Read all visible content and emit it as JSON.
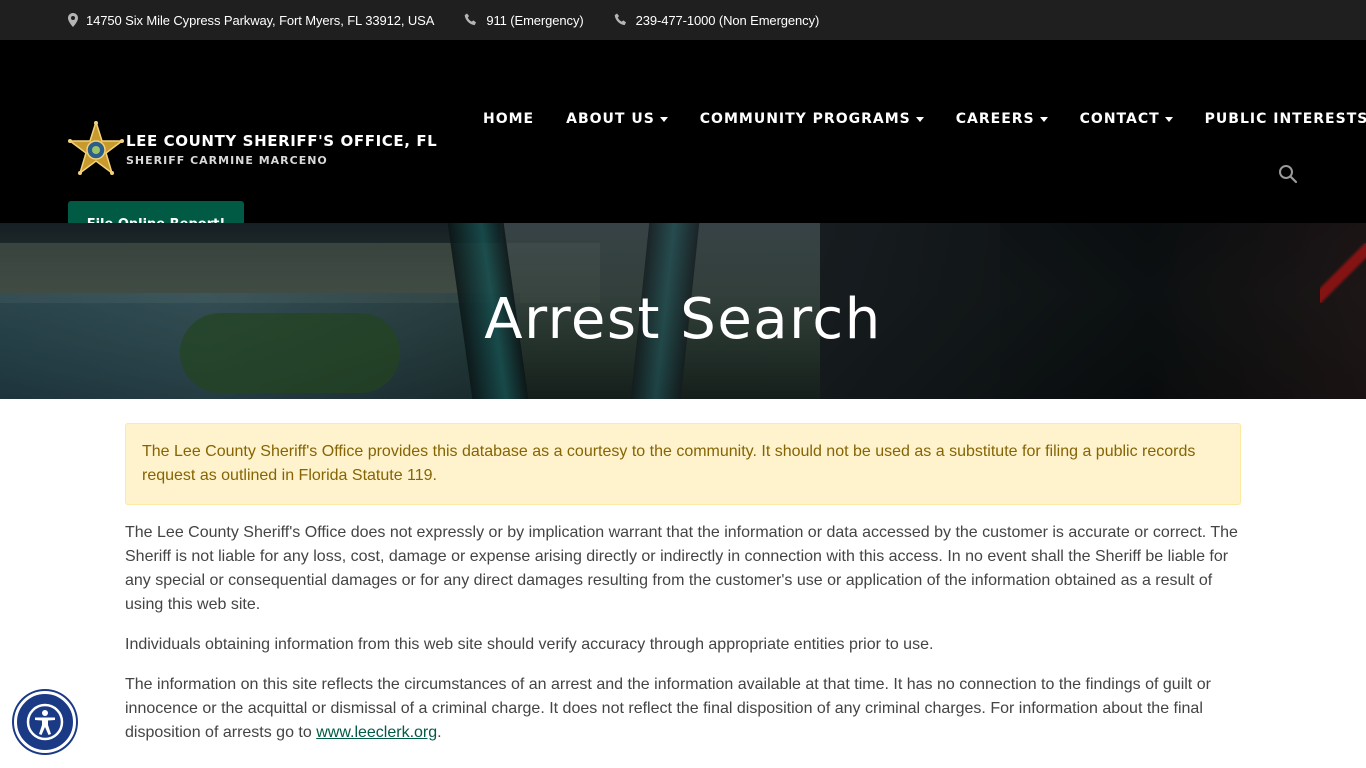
{
  "topbar": {
    "address": "14750 Six Mile Cypress Parkway, Fort Myers, FL 33912, USA",
    "emergency": "911 (Emergency)",
    "non_emergency": "239-477-1000 (Non Emergency)"
  },
  "brand": {
    "title": "LEE COUNTY SHERIFF'S OFFICE, FL",
    "subtitle": "SHERIFF CARMINE MARCENO"
  },
  "nav": [
    {
      "label": "HOME",
      "dropdown": false
    },
    {
      "label": "ABOUT US",
      "dropdown": true
    },
    {
      "label": "COMMUNITY PROGRAMS",
      "dropdown": true
    },
    {
      "label": "CAREERS",
      "dropdown": true
    },
    {
      "label": "CONTACT",
      "dropdown": true
    },
    {
      "label": "PUBLIC INTERESTS",
      "dropdown": true
    }
  ],
  "report_button": "File Online Report!",
  "hero_title": "Arrest Search",
  "alert_text": "The Lee County Sheriff's Office provides this database as a courtesy to the community. It should not be used as a substitute for filing a public records request as outlined in Florida Statute 119.",
  "paragraphs": {
    "disclaimer": "The Lee County Sheriff's Office does not expressly or by implication warrant that the information or data accessed by the customer is accurate or correct. The Sheriff is not liable for any loss, cost, damage or expense arising directly or indirectly in connection with this access. In no event shall the Sheriff be liable for any special or consequential damages or for any direct damages resulting from the customer's use or application of the information obtained as a result of using this web site.",
    "verify": "Individuals obtaining information from this web site should verify accuracy through appropriate entities prior to use.",
    "circumstances_before": "The information on this site reflects the circumstances of an arrest and the information available at that time. It has no connection to the findings of guilt or innocence or the acquittal or dismissal of a criminal charge. It does not reflect the final disposition of any criminal charges. For information about the final disposition of arrests go to ",
    "circumstances_link": "www.leeclerk.org",
    "circumstances_after": "."
  },
  "colors": {
    "topbar_bg": "#1f1f1f",
    "header_bg": "#000000",
    "button_green": "#005a44",
    "alert_bg": "#fff3cd",
    "alert_text": "#856404",
    "a11y_blue": "#1b3a86"
  },
  "icons": {
    "address": "map-marker-icon",
    "phone": "phone-icon",
    "search": "search-icon",
    "accessibility": "accessibility-icon",
    "logo": "sheriff-star-badge"
  }
}
